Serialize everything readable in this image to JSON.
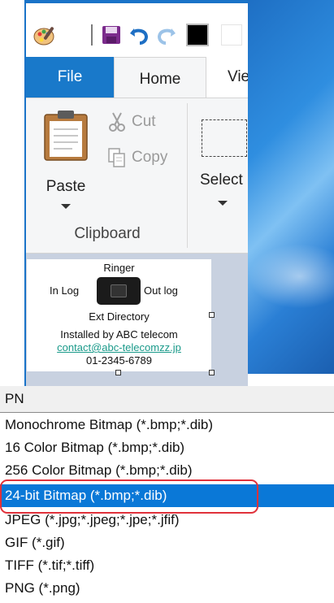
{
  "quick_access": {
    "icons": [
      "paint-app-icon",
      "save-icon",
      "undo-icon",
      "redo-icon",
      "black-color-icon"
    ]
  },
  "tabs": {
    "file": "File",
    "home": "Home",
    "view": "View"
  },
  "ribbon": {
    "paste": "Paste",
    "cut": "Cut",
    "copy": "Copy",
    "clipboard_group": "Clipboard",
    "select": "Select"
  },
  "canvas_image": {
    "ringer": "Ringer",
    "in_log": "In Log",
    "out_log": "Out log",
    "ext_directory": "Ext Directory",
    "installed_by": "Installed by ABC telecom",
    "email": "contact@abc-telecomzz.jp",
    "phone": "01-2345-6789"
  },
  "save_as_type": {
    "current_value": "PN",
    "options": [
      "Monochrome Bitmap (*.bmp;*.dib)",
      "16 Color Bitmap (*.bmp;*.dib)",
      "256 Color Bitmap (*.bmp;*.dib)",
      "24-bit Bitmap (*.bmp;*.dib)",
      "JPEG (*.jpg;*.jpeg;*.jpe;*.jfif)",
      "GIF (*.gif)",
      "TIFF (*.tif;*.tiff)",
      "PNG (*.png)"
    ],
    "selected_index": 3
  },
  "colors": {
    "accent_blue": "#1979ca",
    "selection_blue": "#0a78d7",
    "highlight_red": "#e0313a"
  }
}
